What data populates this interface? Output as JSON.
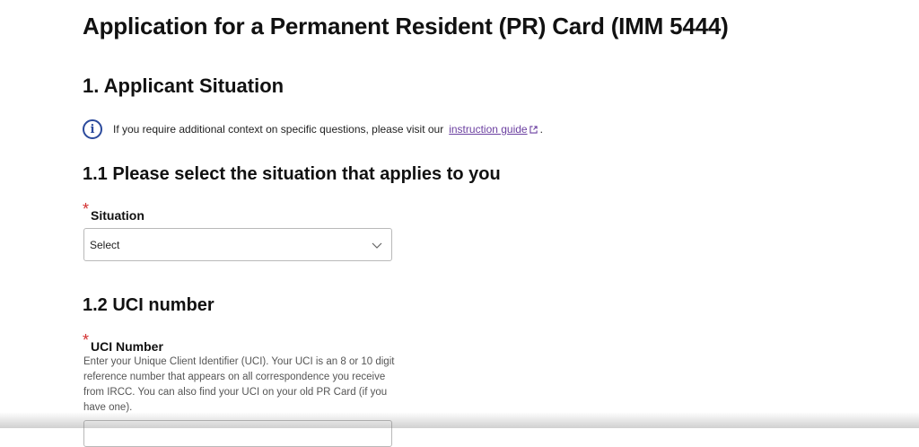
{
  "page": {
    "title": "Application for a Permanent Resident (PR) Card (IMM 5444)"
  },
  "section": {
    "title": "1. Applicant Situation"
  },
  "info": {
    "text": "If you require additional context on specific questions, please visit our",
    "link_text": "instruction guide",
    "trailing": "."
  },
  "question_1": {
    "title": "1.1 Please select the situation that applies to you",
    "required_mark": "*",
    "label": "Situation",
    "select_value": "Select"
  },
  "question_2": {
    "title": "1.2 UCI number",
    "required_mark": "*",
    "label": "UCI Number",
    "help": "Enter your Unique Client Identifier (UCI). Your UCI is an 8 or 10 digit reference number that appears on all correspondence you receive from IRCC. You can also find your UCI on your old PR Card (if you have one)."
  },
  "colors": {
    "link": "#6b3fa0",
    "required": "#d32f2f",
    "info_icon": "#2b4a9c"
  },
  "icons": {
    "info": "info-circle-icon",
    "external": "external-link-icon",
    "chevron": "chevron-down-icon"
  }
}
